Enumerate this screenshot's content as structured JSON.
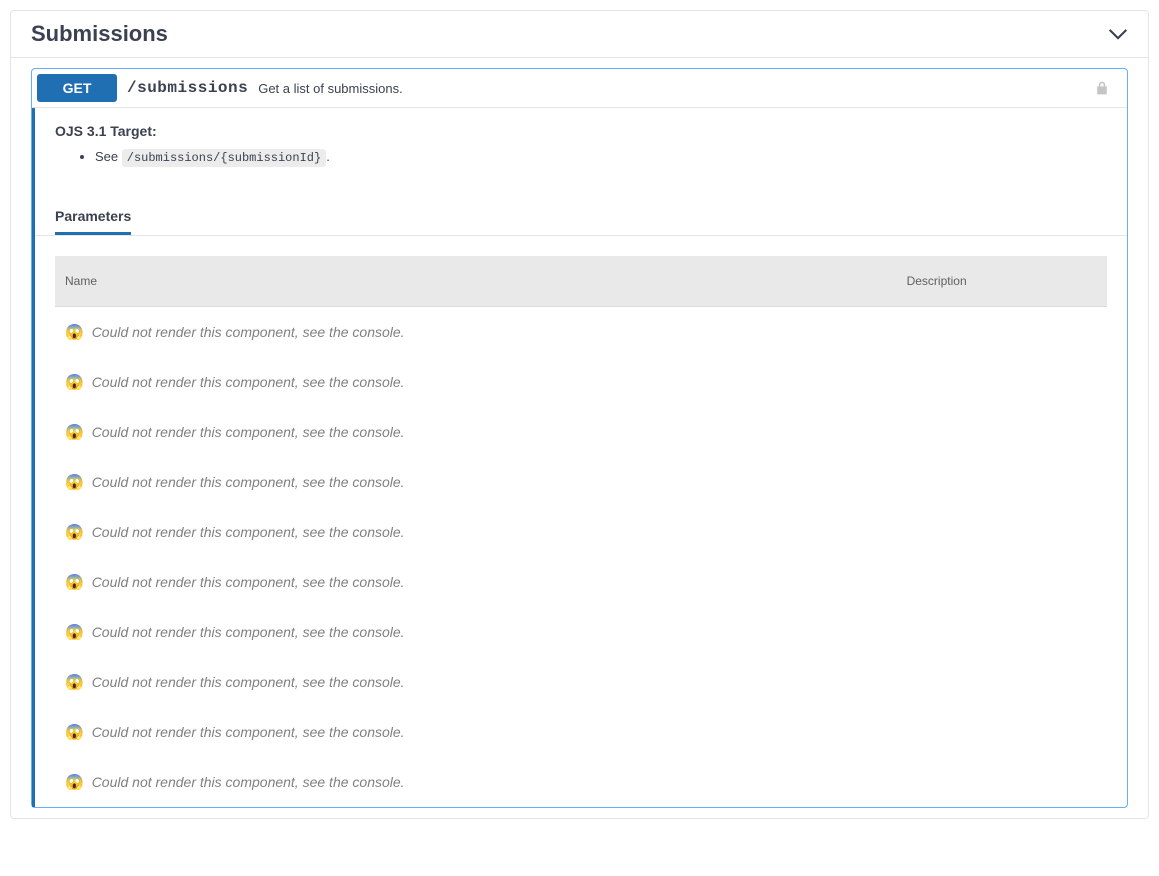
{
  "section": {
    "title": "Submissions"
  },
  "operation": {
    "method": "GET",
    "path": "/submissions",
    "summary": "Get a list of submissions.",
    "target_heading": "OJS 3.1 Target:",
    "see_prefix": "See ",
    "see_path": "/submissions/{submissionId}",
    "see_suffix": "."
  },
  "params": {
    "tab_label": "Parameters",
    "columns": {
      "name": "Name",
      "description": "Description"
    },
    "error_emoji": "😱",
    "error_message": "Could not render this component, see the console.",
    "rows": [
      {},
      {},
      {},
      {},
      {},
      {},
      {},
      {},
      {},
      {}
    ]
  }
}
